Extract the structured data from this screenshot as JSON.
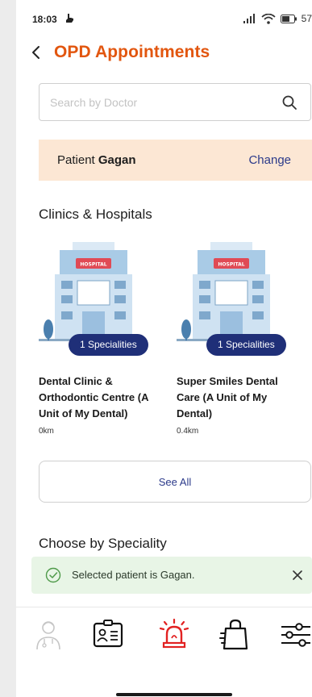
{
  "status_bar": {
    "time": "18:03",
    "battery": "57"
  },
  "header": {
    "title": "OPD Appointments"
  },
  "search": {
    "placeholder": "Search by Doctor"
  },
  "patient": {
    "prefix": "Patient",
    "name": "Gagan",
    "change_label": "Change"
  },
  "sections": {
    "clinics": "Clinics & Hospitals",
    "speciality": "Choose by Speciality"
  },
  "clinics": [
    {
      "name": "Dental Clinic & Orthodontic Centre (A Unit of My Dental)",
      "distance": "0km",
      "specialities": "1 Specialities",
      "sign": "HOSPITAL"
    },
    {
      "name": "Super Smiles Dental Care (A Unit of My Dental)",
      "distance": "0.4km",
      "specialities": "1 Specialities",
      "sign": "HOSPITAL"
    }
  ],
  "see_all_label": "See All",
  "toast": {
    "message": "Selected patient is Gagan."
  },
  "bottom_nav": [
    {
      "icon": "doctor-icon",
      "active": false
    },
    {
      "icon": "id-card-icon",
      "active": false
    },
    {
      "icon": "emergency-alarm-icon",
      "active": true
    },
    {
      "icon": "shopping-bag-icon",
      "active": false
    },
    {
      "icon": "settings-sliders-icon",
      "active": false
    }
  ],
  "colors": {
    "accent": "#e2560f",
    "link": "#2b3a8a",
    "banner_bg": "#fce7d4",
    "pill_bg": "#1f2f78",
    "toast_bg": "#e8f5e6",
    "alert": "#e22222"
  }
}
